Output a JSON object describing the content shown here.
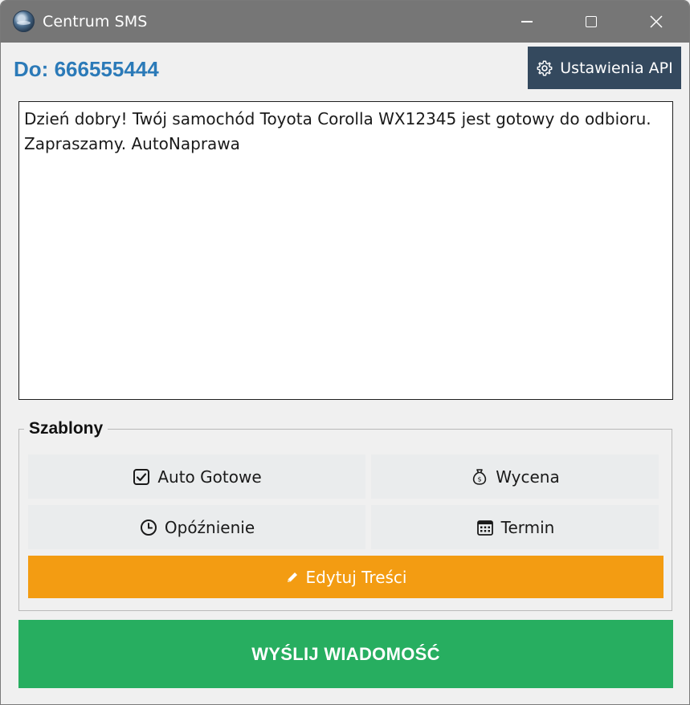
{
  "window": {
    "title": "Centrum SMS",
    "app_icon": "globe-app-icon",
    "controls": {
      "minimize": "minimize-icon",
      "maximize": "maximize-icon",
      "close": "close-icon"
    }
  },
  "header": {
    "recipient_label": "Do:",
    "recipient_number": "666555444",
    "api_button": {
      "label": "Ustawienia API",
      "icon": "gear-icon"
    }
  },
  "message": {
    "text": "Dzień dobry! Twój samochód Toyota Corolla WX12345 jest gotowy do odbioru. Zapraszamy. AutoNaprawa"
  },
  "templates": {
    "legend": "Szablony",
    "buttons": [
      {
        "label": "Auto Gotowe",
        "icon": "checkbox-check-icon"
      },
      {
        "label": "Wycena",
        "icon": "money-bag-icon"
      },
      {
        "label": "Opóźnienie",
        "icon": "clock-icon"
      },
      {
        "label": "Termin",
        "icon": "calendar-icon"
      }
    ],
    "edit_button": {
      "label": "Edytuj Treści",
      "icon": "pencil-icon"
    }
  },
  "send_button": {
    "label": "WYŚLIJ WIADOMOŚĆ"
  },
  "colors": {
    "titlebar": "#767676",
    "recipient": "#2b7ab8",
    "api_button": "#34495e",
    "edit_button": "#f39c12",
    "send_button": "#27ae60",
    "template_button": "#eaeced"
  }
}
